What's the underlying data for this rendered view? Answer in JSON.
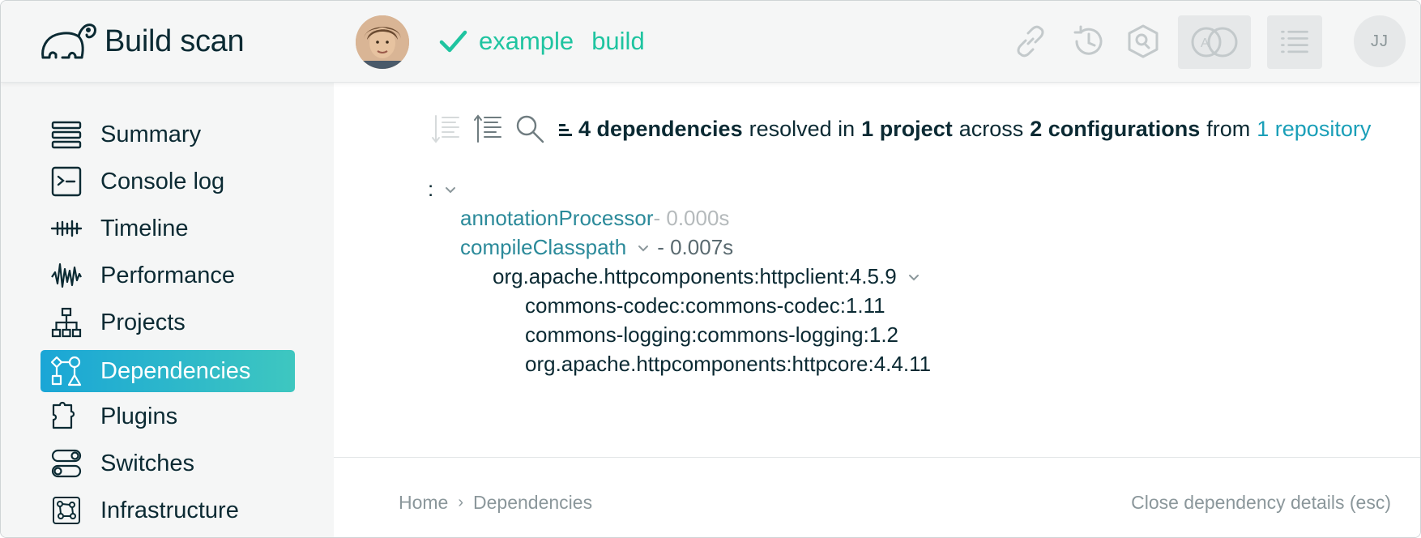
{
  "header": {
    "app_title": "Build scan",
    "status_words": [
      "example",
      "build"
    ],
    "user_initials": "JJ",
    "icons": [
      "link-icon",
      "history-icon",
      "search-hex-icon",
      "compare-icon",
      "list-icon"
    ]
  },
  "sidebar": {
    "items": [
      {
        "label": "Summary",
        "icon": "summary-icon"
      },
      {
        "label": "Console log",
        "icon": "console-icon"
      },
      {
        "label": "Timeline",
        "icon": "timeline-icon"
      },
      {
        "label": "Performance",
        "icon": "performance-icon"
      },
      {
        "label": "Projects",
        "icon": "projects-icon"
      },
      {
        "label": "Dependencies",
        "icon": "dependencies-icon",
        "active": true
      },
      {
        "label": "Plugins",
        "icon": "plugins-icon"
      },
      {
        "label": "Switches",
        "icon": "switches-icon"
      },
      {
        "label": "Infrastructure",
        "icon": "infrastructure-icon"
      }
    ]
  },
  "summary": {
    "count": "4 dependencies",
    "t1": "resolved in",
    "projects": "1 project",
    "t2": "across",
    "configurations": "2 configurations",
    "t3": "from",
    "repository": "1 repository"
  },
  "tree": {
    "root": ":",
    "config1": {
      "name": "annotationProcessor",
      "time": "- 0.000s"
    },
    "config2": {
      "name": "compileClasspath",
      "time": "- 0.007s"
    },
    "dep": "org.apache.httpcomponents:httpclient:4.5.9",
    "children": [
      "commons-codec:commons-codec:1.11",
      "commons-logging:commons-logging:1.2",
      "org.apache.httpcomponents:httpcore:4.4.11"
    ]
  },
  "footer": {
    "crumb_home": "Home",
    "crumb_sep": "›",
    "crumb_current": "Dependencies",
    "close_label": "Close dependency details (esc)"
  },
  "colors": {
    "accent_teal": "#1fc4a0",
    "link_blue": "#1a9fb8",
    "active_gradient_start": "#1aa6d6",
    "active_gradient_end": "#3ec7c0"
  }
}
